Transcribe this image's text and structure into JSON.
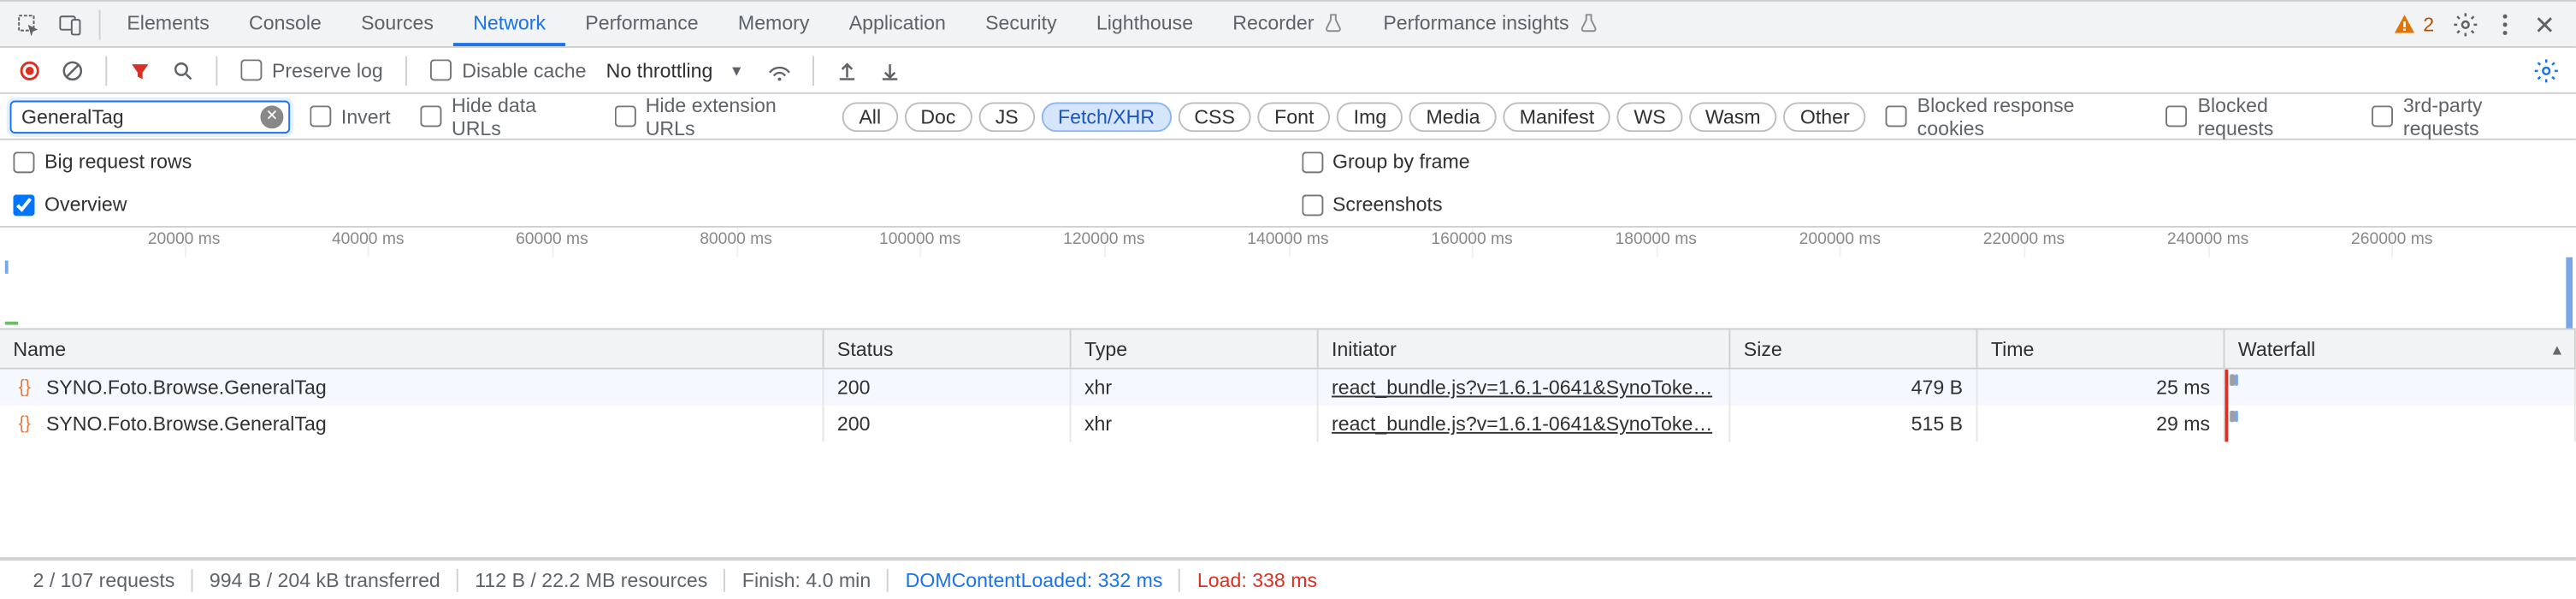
{
  "tabs": {
    "items": [
      "Elements",
      "Console",
      "Sources",
      "Network",
      "Performance",
      "Memory",
      "Application",
      "Security",
      "Lighthouse",
      "Recorder",
      "Performance insights"
    ],
    "active": "Network",
    "experimental_indices": [
      9,
      10
    ]
  },
  "warnings": {
    "count": "2"
  },
  "toolbar": {
    "preserve_log": "Preserve log",
    "disable_cache": "Disable cache",
    "throttling": "No throttling"
  },
  "filter": {
    "value": "GeneralTag",
    "invert": "Invert",
    "hide_data_urls": "Hide data URLs",
    "hide_ext_urls": "Hide extension URLs",
    "types": [
      "All",
      "Doc",
      "JS",
      "Fetch/XHR",
      "CSS",
      "Font",
      "Img",
      "Media",
      "Manifest",
      "WS",
      "Wasm",
      "Other"
    ],
    "types_active": [
      "Fetch/XHR"
    ],
    "blocked_response": "Blocked response cookies",
    "blocked_requests": "Blocked requests",
    "third_party": "3rd-party requests"
  },
  "options": {
    "big_rows": "Big request rows",
    "overview": "Overview",
    "group_by_frame": "Group by frame",
    "screenshots": "Screenshots",
    "overview_checked": true
  },
  "timeline": {
    "ticks": [
      "20000 ms",
      "40000 ms",
      "60000 ms",
      "80000 ms",
      "100000 ms",
      "120000 ms",
      "140000 ms",
      "160000 ms",
      "180000 ms",
      "200000 ms",
      "220000 ms",
      "240000 ms",
      "260000 ms"
    ]
  },
  "grid": {
    "headers": {
      "name": "Name",
      "status": "Status",
      "type": "Type",
      "initiator": "Initiator",
      "size": "Size",
      "time": "Time",
      "waterfall": "Waterfall"
    },
    "rows": [
      {
        "name": "SYNO.Foto.Browse.GeneralTag",
        "status": "200",
        "type": "xhr",
        "initiator": "react_bundle.js?v=1.6.1-0641&SynoToke…",
        "size": "479 B",
        "time": "25 ms"
      },
      {
        "name": "SYNO.Foto.Browse.GeneralTag",
        "status": "200",
        "type": "xhr",
        "initiator": "react_bundle.js?v=1.6.1-0641&SynoToke…",
        "size": "515 B",
        "time": "29 ms"
      }
    ]
  },
  "status": {
    "requests": "2 / 107 requests",
    "transferred": "994 B / 204 kB transferred",
    "resources": "112 B / 22.2 MB resources",
    "finish": "Finish: 4.0 min",
    "dcl": "DOMContentLoaded: 332 ms",
    "load": "Load: 338 ms"
  }
}
